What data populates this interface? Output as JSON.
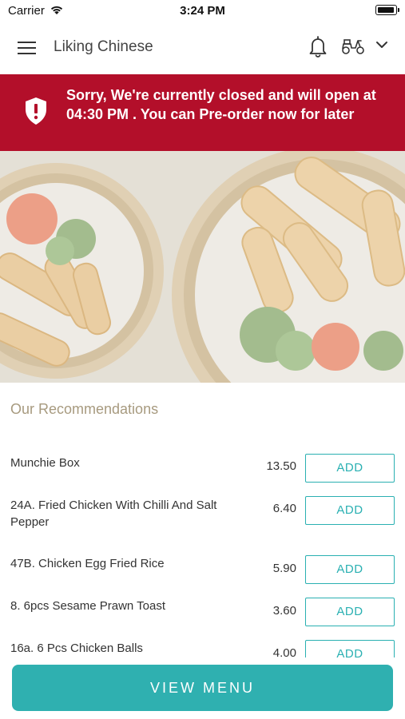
{
  "status_bar": {
    "carrier": "Carrier",
    "time": "3:24 PM"
  },
  "header": {
    "title": "Liking Chinese"
  },
  "banner": {
    "message": "Sorry, We're currently closed and will open at 04:30 PM . You can Pre-order now for later"
  },
  "recommendations": {
    "title": "Our Recommendations",
    "add_label": "ADD",
    "items": [
      {
        "name": "Munchie Box",
        "price": "13.50"
      },
      {
        "name": "24A. Fried Chicken With Chilli And Salt Pepper",
        "price": "6.40"
      },
      {
        "name": "47B. Chicken Egg Fried Rice",
        "price": "5.90"
      },
      {
        "name": "8. 6pcs Sesame Prawn Toast",
        "price": "3.60"
      },
      {
        "name": "16a. 6 Pcs Chicken Balls",
        "price": "4.00"
      }
    ]
  },
  "footer": {
    "view_menu_label": "VIEW MENU"
  },
  "colors": {
    "banner": "#b30f2a",
    "accent": "#2fb0b0",
    "section_title": "#a79a7f"
  },
  "icons": [
    "menu-icon",
    "bell-icon",
    "scooter-icon",
    "chevron-down-icon",
    "shield-icon",
    "wifi-icon",
    "battery-icon"
  ]
}
